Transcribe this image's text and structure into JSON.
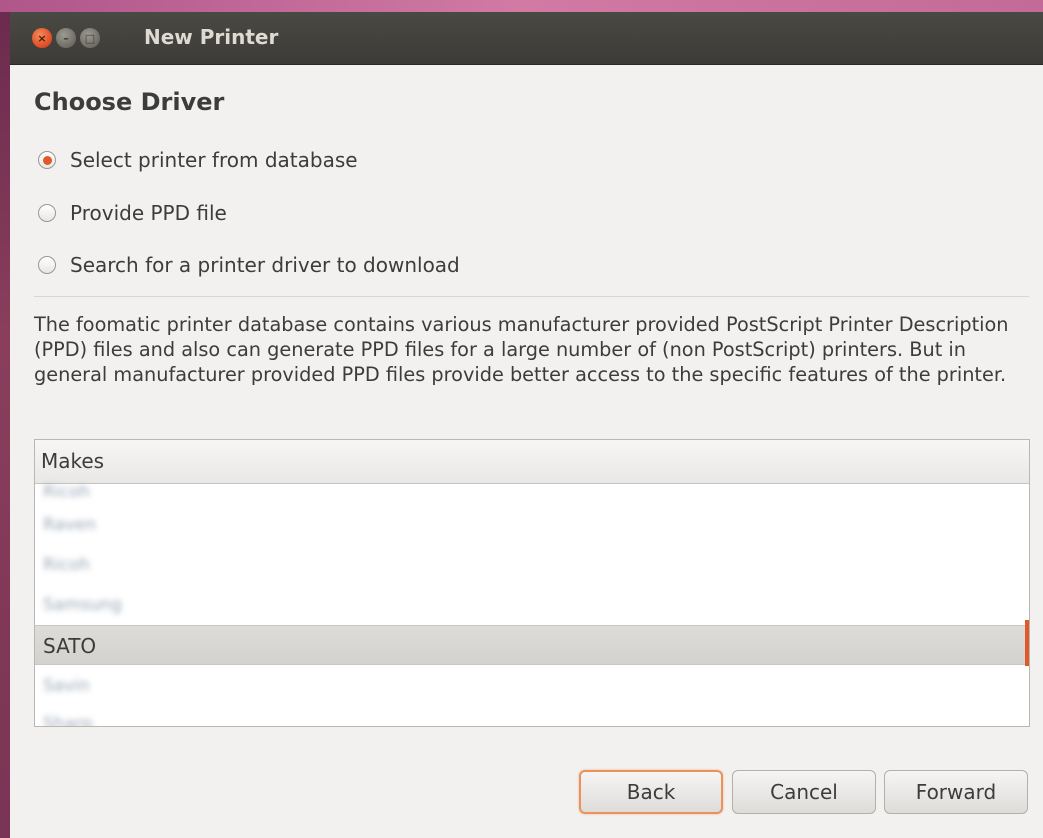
{
  "window": {
    "title": "New Printer",
    "controls": {
      "close_icon": "×",
      "min_icon": "–",
      "max_icon": "□"
    }
  },
  "page": {
    "heading": "Choose Driver"
  },
  "options": [
    {
      "label": "Select printer from database",
      "selected": true
    },
    {
      "label": "Provide PPD file",
      "selected": false
    },
    {
      "label": "Search for a printer driver to download",
      "selected": false
    }
  ],
  "description": "The foomatic printer database contains various manufacturer provided PostScript Printer Description (PPD) files and also can generate PPD files for a large number of (non PostScript) printers. But in general manufacturer provided PPD files provide better access to the specific features of the printer.",
  "makes_list": {
    "header": "Makes",
    "rows": [
      {
        "label": "Ricoh",
        "blurred": true
      },
      {
        "label": "Raven",
        "blurred": true
      },
      {
        "label": "Ricoh",
        "blurred": true
      },
      {
        "label": "Samsung",
        "blurred": true
      },
      {
        "label": "SATO",
        "blurred": false,
        "selected": true
      },
      {
        "label": "Savin",
        "blurred": true
      },
      {
        "label": "Sharp",
        "blurred": true
      }
    ]
  },
  "buttons": {
    "back": "Back",
    "cancel": "Cancel",
    "forward": "Forward"
  },
  "colors": {
    "accent": "#e0592a",
    "titlebar": "#3c3b37",
    "window_bg": "#f2f1f0"
  }
}
